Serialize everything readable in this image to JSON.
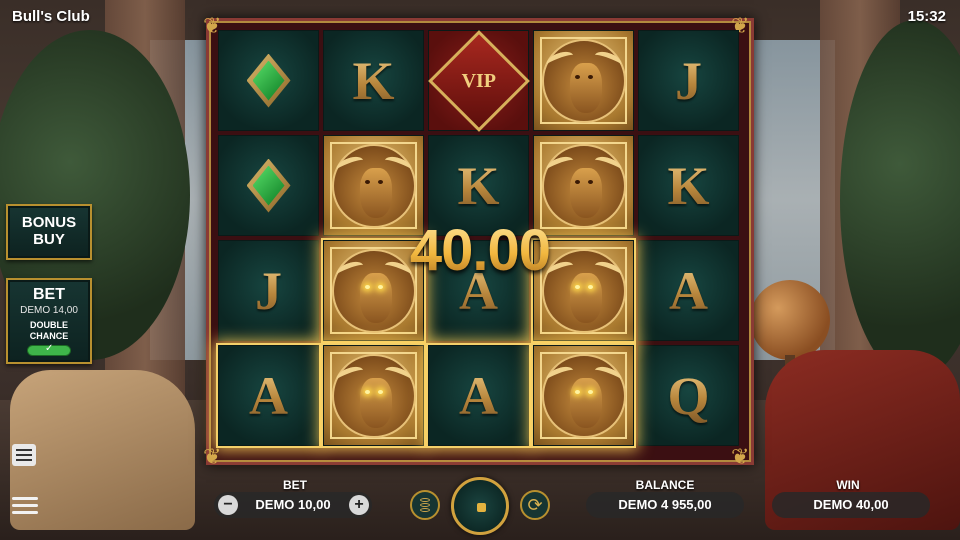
{
  "app": {
    "title": "Bull's Club",
    "clock": "15:32"
  },
  "side": {
    "bonus_buy": [
      "BONUS",
      "BUY"
    ],
    "bet_title": "BET",
    "bet_value": "DEMO 14,00",
    "double_chance": [
      "DOUBLE",
      "CHANCE"
    ],
    "double_chance_on": true
  },
  "reels": {
    "rows": [
      [
        "diamond",
        "K",
        "VIP",
        "bull",
        "J"
      ],
      [
        "diamond",
        "bull",
        "K",
        "bull",
        "K"
      ],
      [
        "J",
        "bull",
        "A",
        "bull",
        "A"
      ],
      [
        "A",
        "bull",
        "A",
        "bull",
        "Q"
      ]
    ],
    "vip_text": "VIP",
    "winning": [
      [
        2,
        1
      ],
      [
        2,
        3
      ],
      [
        3,
        0
      ],
      [
        3,
        1
      ],
      [
        3,
        2
      ],
      [
        3,
        3
      ]
    ]
  },
  "win_amount": "40.00",
  "bottom": {
    "bet_label": "BET",
    "bet_value": "DEMO 10,00",
    "minus": "−",
    "plus": "+",
    "balance_label": "BALANCE",
    "balance_value": "DEMO 4 955,00",
    "win_label": "WIN",
    "win_value": "DEMO 40,00",
    "autoplay_glyph": "⟳"
  },
  "colors": {
    "gold": "#d1a23e",
    "reel_bg": "#0b2623",
    "frame": "#8a3a34",
    "win_glow": "#f4d06a"
  }
}
